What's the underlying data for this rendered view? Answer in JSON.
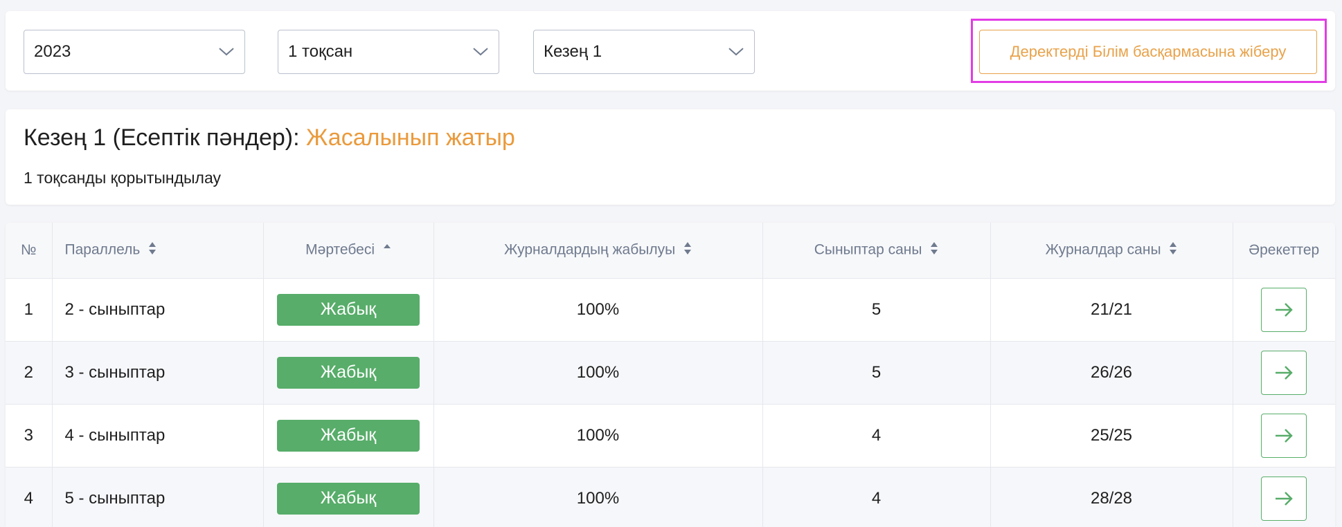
{
  "filters": {
    "year": "2023",
    "quarter": "1 тоқсан",
    "stage": "Кезең 1",
    "send_button": "Деректерді Білім басқармасына жіберу"
  },
  "info": {
    "title": "Кезең 1 (Есептік пәндер):",
    "status": "Жасалынып жатыр",
    "status_color": "#ea9a3c",
    "subtitle": "1 тоқсанды қорытындылау"
  },
  "table": {
    "headers": {
      "num": "№",
      "parallel": "Параллель",
      "status": "Мәртебесі",
      "closing": "Журналдардың жабылуы",
      "classes": "Сыныптар саны",
      "journals": "Журналдар саны",
      "actions": "Әрекеттер"
    },
    "rows": [
      {
        "num": "1",
        "parallel": "2 - сыныптар",
        "status": "Жабық",
        "closing": "100%",
        "classes": "5",
        "journals": "21/21"
      },
      {
        "num": "2",
        "parallel": "3 - сыныптар",
        "status": "Жабық",
        "closing": "100%",
        "classes": "5",
        "journals": "26/26"
      },
      {
        "num": "3",
        "parallel": "4 - сыныптар",
        "status": "Жабық",
        "closing": "100%",
        "classes": "4",
        "journals": "25/25"
      },
      {
        "num": "4",
        "parallel": "5 - сыныптар",
        "status": "Жабық",
        "closing": "100%",
        "classes": "4",
        "journals": "28/28"
      }
    ]
  },
  "colors": {
    "accent_orange": "#e8a24a",
    "badge_green": "#57ad69",
    "highlight_magenta": "#e23ce6"
  },
  "icons": {
    "dropdown": "chevron-down-icon",
    "sort": "sort-icon",
    "sort_asc": "sort-asc-icon",
    "action": "arrow-right-icon"
  }
}
